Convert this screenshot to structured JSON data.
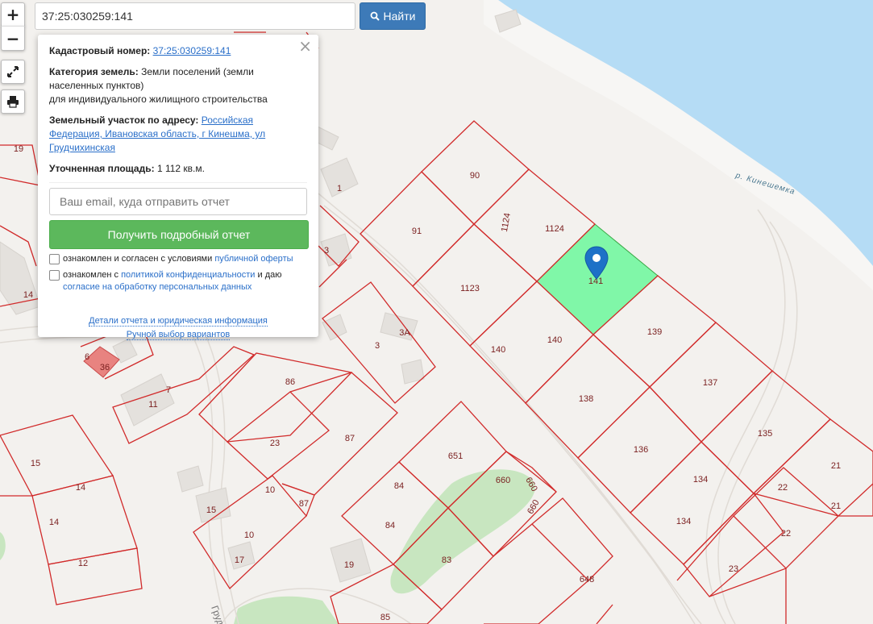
{
  "search": {
    "value": "37:25:030259:141",
    "button_label": "Найти"
  },
  "controls": {
    "zoom_in": "+",
    "zoom_out": "−"
  },
  "popup": {
    "close": "×",
    "cadastral_label": "Кадастровый номер:",
    "cadastral_value": "37:25:030259:141",
    "category_label": "Категория земель:",
    "category_value": "Земли поселений (земли населенных пунктов)",
    "category_use": "для индивидуального жилищного строительства",
    "address_label": "Земельный участок по адресу:",
    "address_value": "Российская Федерация, Ивановская область, г Кинешма, ул Грудчихинская",
    "area_label": "Уточненная площадь:",
    "area_value": "1 112 кв.м.",
    "email_placeholder": "Ваш email, куда отправить отчет",
    "report_button": "Получить подробный отчет",
    "consent1_text": "ознакомлен и согласен с условиями",
    "consent1_link": "публичной оферты",
    "consent2_text": "ознакомлен с",
    "consent2_link": "политикой конфиденциальности",
    "consent2_mid": "и даю",
    "consent2_link2": "согласие на обработку персональных данных",
    "details_link": "Детали отчета и юридическая информация",
    "manual_link": "Ручной выбор вариантов"
  },
  "map": {
    "river_label": "р. Кинешемка",
    "street_label": "Груд",
    "selected_plot": "141",
    "plot_labels": [
      "90",
      "91",
      "1124",
      "1124",
      "141",
      "1123",
      "140",
      "140",
      "139",
      "138",
      "137",
      "136",
      "135",
      "134",
      "134",
      "21",
      "21",
      "22",
      "22",
      "23",
      "651",
      "660",
      "660",
      "660",
      "84",
      "84",
      "83",
      "85",
      "648",
      "86",
      "23",
      "87",
      "87",
      "10",
      "10",
      "7",
      "11",
      "3",
      "3А",
      "1",
      "3",
      "19",
      "14",
      "6",
      "36",
      "15",
      "14",
      "14",
      "12",
      "15",
      "17",
      "19"
    ],
    "colors": {
      "selected_fill": "#80f7a8",
      "boundary": "#d12b2b",
      "water": "#b5dcf5"
    }
  }
}
